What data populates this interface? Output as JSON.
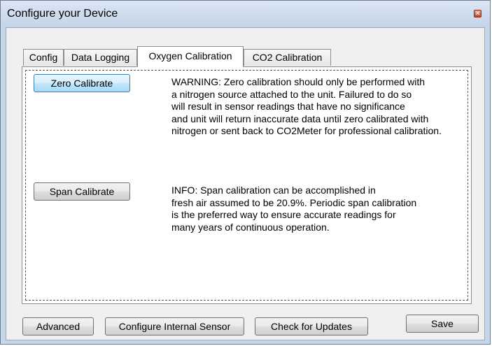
{
  "window": {
    "title": "Configure your Device",
    "close_glyph": "✕"
  },
  "tabs": [
    {
      "label": "Config",
      "active": false
    },
    {
      "label": "Data Logging",
      "active": false
    },
    {
      "label": "Oxygen Calibration",
      "active": true
    },
    {
      "label": "CO2 Calibration",
      "active": false
    }
  ],
  "panel": {
    "zero_button_label": "Zero Calibrate",
    "zero_warning": "WARNING: Zero calibration should only be performed with\na nitrogen source attached to the unit. Failured to do so\nwill result in sensor readings that have no significance\nand unit will return inaccurate data until zero calibrated with\nnitrogen or sent back to CO2Meter for professional calibration.",
    "span_button_label": "Span Calibrate",
    "span_info": "INFO: Span calibration can be accomplished in\nfresh air assumed to be 20.9%. Periodic span calibration\nis the preferred way to ensure accurate readings for\nmany years of continuous operation."
  },
  "footer": {
    "advanced_label": "Advanced",
    "configure_sensor_label": "Configure Internal Sensor",
    "check_updates_label": "Check for Updates",
    "save_label": "Save"
  },
  "colors": {
    "title_bar": "#c4d4e8",
    "client_bg": "#f0f0f0",
    "focused_button": "#bee6fd"
  },
  "icons": {
    "close": "close-icon"
  }
}
